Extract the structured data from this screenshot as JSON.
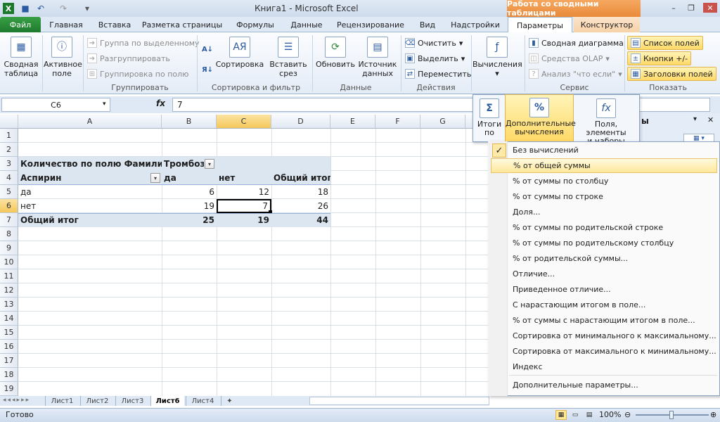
{
  "titlebar": {
    "title": "Книга1  -  Microsoft Excel",
    "context_title": "Работа со сводными таблицами",
    "excel_icon": "excel-icon",
    "save_icon": "save-icon",
    "undo_icon": "undo-icon",
    "redo_icon": "redo-icon"
  },
  "tabs": {
    "file": "Файл",
    "home": "Главная",
    "insert": "Вставка",
    "layout": "Разметка страницы",
    "formulas": "Формулы",
    "data": "Данные",
    "review": "Рецензирование",
    "view": "Вид",
    "addins": "Надстройки",
    "params": "Параметры",
    "designer": "Конструктор"
  },
  "ribbon": {
    "pivot_table": "Сводная\nтаблица",
    "active_field": "Активное\nполе",
    "group_selection": "Группа по выделенному",
    "ungroup": "Разгруппировать",
    "group_field": "Группировка по полю",
    "group_label": "Группировать",
    "sort": "Сортировка",
    "insert_slicer": "Вставить\nсрез",
    "sort_label": "Сортировка и фильтр",
    "refresh": "Обновить",
    "data_source": "Источник\nданных",
    "data_label": "Данные",
    "clear": "Очистить",
    "select": "Выделить",
    "move": "Переместить",
    "actions_label": "Действия",
    "calculations": "Вычисления",
    "pivot_chart": "Сводная диаграмма",
    "olap_tools": "Средства OLAP",
    "whatif": "Анализ \"что если\"",
    "service_label": "Сервис",
    "field_list": "Список полей",
    "buttons": "Кнопки +/-",
    "headers": "Заголовки полей",
    "show_label": "Показать"
  },
  "formula": {
    "namebox": "C6",
    "fx": "fx",
    "value": "7"
  },
  "columns": [
    "A",
    "B",
    "C",
    "D",
    "E",
    "F",
    "G"
  ],
  "rows": [
    "1",
    "2",
    "3",
    "4",
    "5",
    "6",
    "7",
    "8",
    "9",
    "10",
    "11",
    "12",
    "13",
    "14",
    "15",
    "16",
    "17",
    "18",
    "19"
  ],
  "pivot": {
    "a3": "Количество по полю Фамилия",
    "b3": "Тромбоз",
    "a4": "Аспирин",
    "b4": "да",
    "c4": "нет",
    "d4": "Общий итог",
    "a5": "да",
    "b5": "6",
    "c5": "12",
    "d5": "18",
    "a6": "нет",
    "b6": "19",
    "c6": "7",
    "d6": "26",
    "a7": "Общий итог",
    "b7": "25",
    "c7": "19",
    "d7": "44"
  },
  "sheets": [
    "Лист1",
    "Лист2",
    "Лист3",
    "Лист6",
    "Лист4"
  ],
  "status": {
    "ready": "Готово",
    "zoom": "100%"
  },
  "calc_panel": {
    "totals": "Итоги\nпо",
    "additional": "Дополнительные\nвычисления",
    "fields": "Поля, элементы\nи наборы"
  },
  "menu": {
    "items": [
      "Без вычислений",
      "% от общей суммы",
      "% от суммы по столбцу",
      "% от суммы по строке",
      "Доля...",
      "% от суммы по родительской строке",
      "% от суммы по родительскому столбцу",
      "% от родительской суммы...",
      "Отличие...",
      "Приведенное отличие...",
      "С нарастающим итогом в поле...",
      "% от суммы с нарастающим итогом в поле...",
      "Сортировка от минимального к максимальному...",
      "Сортировка от максимального к минимальному...",
      "Индекс",
      "Дополнительные параметры..."
    ]
  },
  "taskpane": {
    "title_fragment": "ы"
  }
}
